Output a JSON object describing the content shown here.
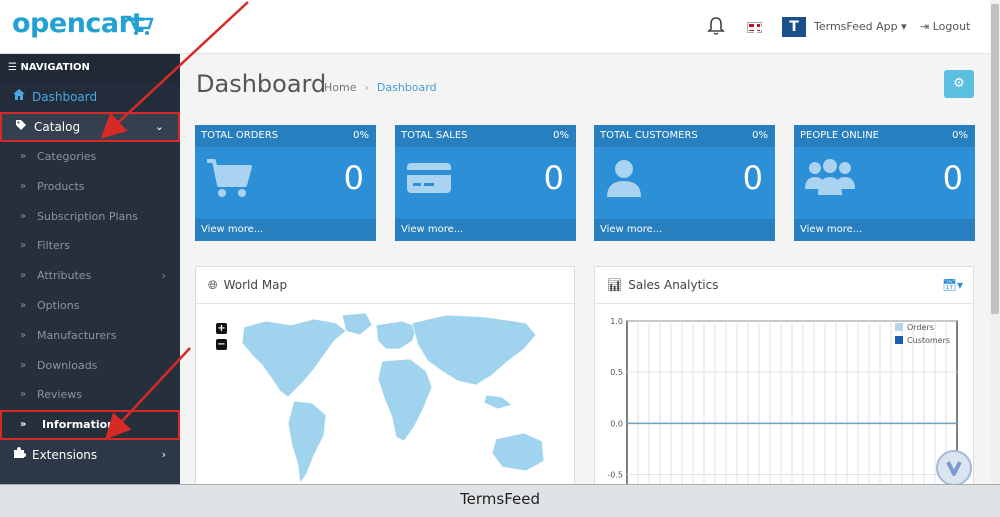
{
  "header": {
    "logo_text": "opencart",
    "user_name": "TermsFeed App ▾",
    "logout_label": "Logout",
    "brand_mark": "T"
  },
  "sidebar": {
    "title": "NAVIGATION",
    "dashboard": "Dashboard",
    "catalog": "Catalog",
    "catalog_items": [
      "Categories",
      "Products",
      "Subscription Plans",
      "Filters",
      "Attributes",
      "Options",
      "Manufacturers",
      "Downloads",
      "Reviews",
      "Information"
    ],
    "extensions": "Extensions"
  },
  "main": {
    "title": "Dashboard",
    "breadcrumb": [
      "Home",
      "Dashboard"
    ],
    "tiles": [
      {
        "title": "TOTAL ORDERS",
        "pct": "0%",
        "value": "0",
        "link": "View more..."
      },
      {
        "title": "TOTAL SALES",
        "pct": "0%",
        "value": "0",
        "link": "View more..."
      },
      {
        "title": "TOTAL CUSTOMERS",
        "pct": "0%",
        "value": "0",
        "link": "View more..."
      },
      {
        "title": "PEOPLE ONLINE",
        "pct": "0%",
        "value": "0",
        "link": "View more..."
      }
    ],
    "map_title": "World Map",
    "map_zoom_in": "+",
    "map_zoom_out": "−",
    "chart_title": "Sales Analytics"
  },
  "chart_data": {
    "type": "line",
    "y_ticks": [
      "1.0",
      "0.5",
      "0.0",
      "-0.5"
    ],
    "ylim": [
      -0.7,
      1.0
    ],
    "series": [
      {
        "name": "Orders",
        "color": "#b2d8f0",
        "values": [
          0
        ]
      },
      {
        "name": "Customers",
        "color": "#1b5eb2",
        "values": [
          0
        ]
      }
    ],
    "legend_position": "top-right"
  },
  "footer": {
    "text": "TermsFeed"
  },
  "colors": {
    "accent": "#2d8fd6",
    "sidebar_bg": "#2c3848",
    "highlight_border": "#d72a25",
    "annotation_arrow": "#d72a25"
  }
}
